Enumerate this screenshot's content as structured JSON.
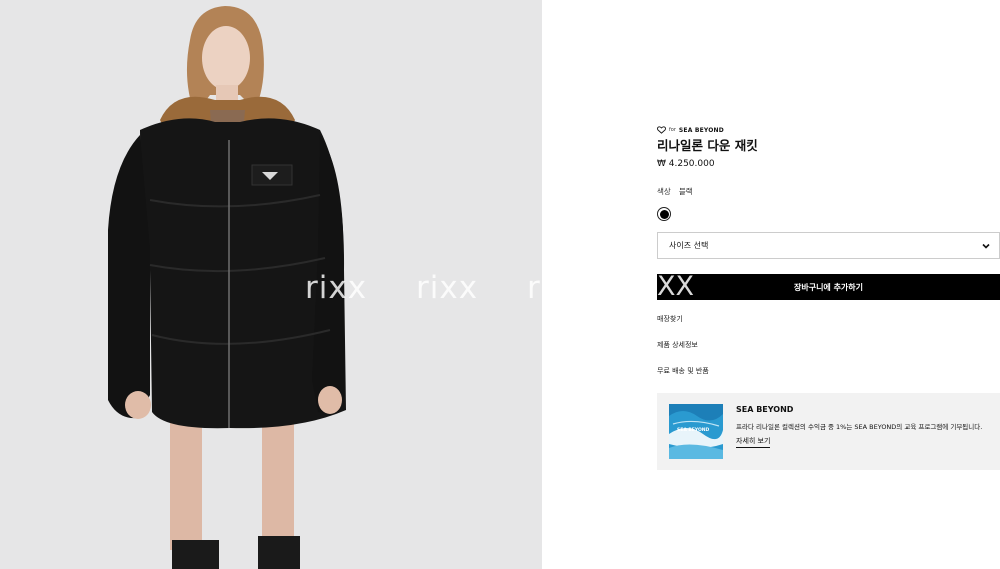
{
  "image_panel": {
    "watermark": "rixx"
  },
  "product": {
    "badge_by": "for",
    "badge_brand": "SEA BEYOND",
    "title": "리나일론 다운 재킷",
    "price": "₩ 4.250.000",
    "color_label": "색상",
    "color_value": "블랙",
    "size_placeholder": "사이즈 선택",
    "add_to_cart": "장바구니에 추가하기",
    "cart_watermark": "XX"
  },
  "links": {
    "store": "매장찾기",
    "details": "제품 상세정보",
    "shipping": "무료 배송 및 반품"
  },
  "promo": {
    "thumb_label": "SEA BEYOND",
    "title": "SEA BEYOND",
    "description": "프라다 리나일론 컬렉션의 수익금 중 1%는 SEA BEYOND의 교육 프로그램에 기부됩니다.",
    "link": "자세히 보기"
  },
  "colors": {
    "image_bg": "#e6e6e7",
    "jacket": "#151515",
    "button": "#000000",
    "promo_bg": "#f2f2f2"
  }
}
